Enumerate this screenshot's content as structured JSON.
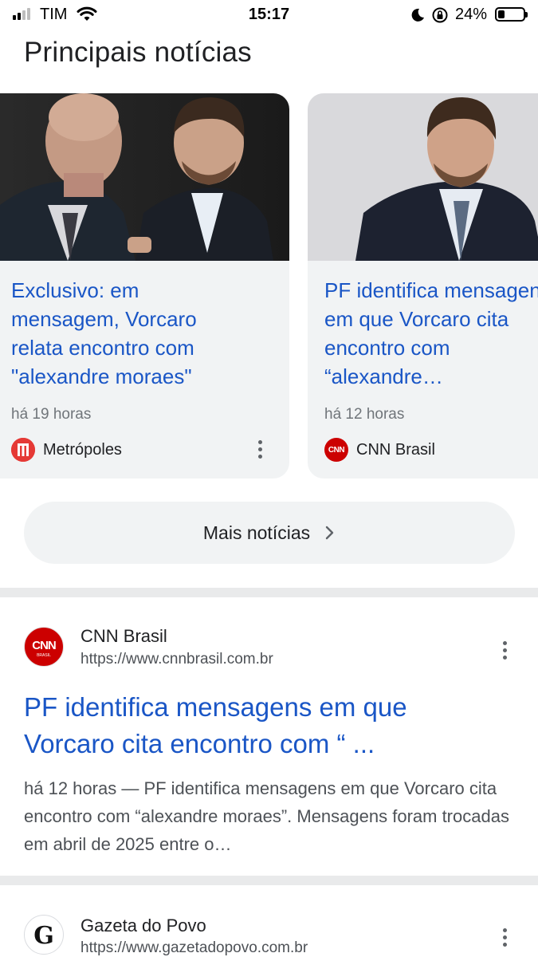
{
  "status_bar": {
    "carrier": "TIM",
    "time": "15:17",
    "battery_percent": "24%",
    "battery_level": 0.24,
    "signal_bars": 2,
    "signal_bars_total": 4
  },
  "top_stories": {
    "title": "Principais notícias",
    "cards": [
      {
        "headline": "Exclusivo: em mensagem, Vorcaro relata encontro com \"alexandre moraes\"",
        "time": "há 19 horas",
        "source": "Metrópoles",
        "logo_icon": "metropoles-logo-icon"
      },
      {
        "headline": "PF identifica mensagens em que Vorcaro cita encontro com “alexandre…",
        "time": "há 12 horas",
        "source": "CNN Brasil",
        "logo_icon": "cnn-logo-icon"
      }
    ],
    "more_label": "Mais notícias"
  },
  "results": [
    {
      "site": "CNN Brasil",
      "url": "https://www.cnnbrasil.com.br",
      "title": "PF identifica mensagens em que Vorcaro cita encontro com “ ...",
      "snippet_time": "há 12 horas",
      "snippet_sep": " — ",
      "snippet": "PF identifica mensagens em que Vorcaro cita encontro com “alexandre moraes”. Mensagens foram trocadas em abril de 2025 entre o…"
    },
    {
      "site": "Gazeta do Povo",
      "url": "https://www.gazetadopovo.com.br"
    }
  ],
  "colors": {
    "link_blue": "#1a56c6",
    "card_bg": "#f1f3f4",
    "cnn_red": "#cc0000",
    "metropoles_red": "#e53935"
  }
}
